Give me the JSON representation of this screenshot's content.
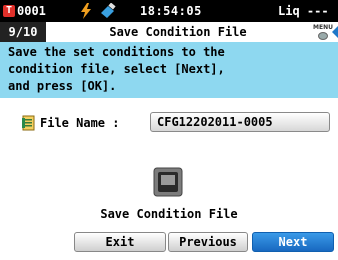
{
  "status_bar": {
    "device_id": "0001",
    "badge_icon": "t-badge-icon",
    "time": "18:54:05",
    "mode": "Liq ---"
  },
  "title_bar": {
    "page": "9/10",
    "title": "Save Condition File",
    "menu_label": "MENU"
  },
  "instructions": [
    "Save the set conditions to the",
    "condition file, select [Next],",
    "and press [OK]."
  ],
  "file": {
    "label": "File Name :",
    "value": "CFG12202011-0005"
  },
  "save_caption": "Save Condition File",
  "buttons": {
    "exit": "Exit",
    "previous": "Previous",
    "next": "Next"
  },
  "colors": {
    "status_bg": "#000000",
    "instruction_bg": "#8ed8f0",
    "next_button": "#1f78c8",
    "badge": "#e0302a"
  }
}
